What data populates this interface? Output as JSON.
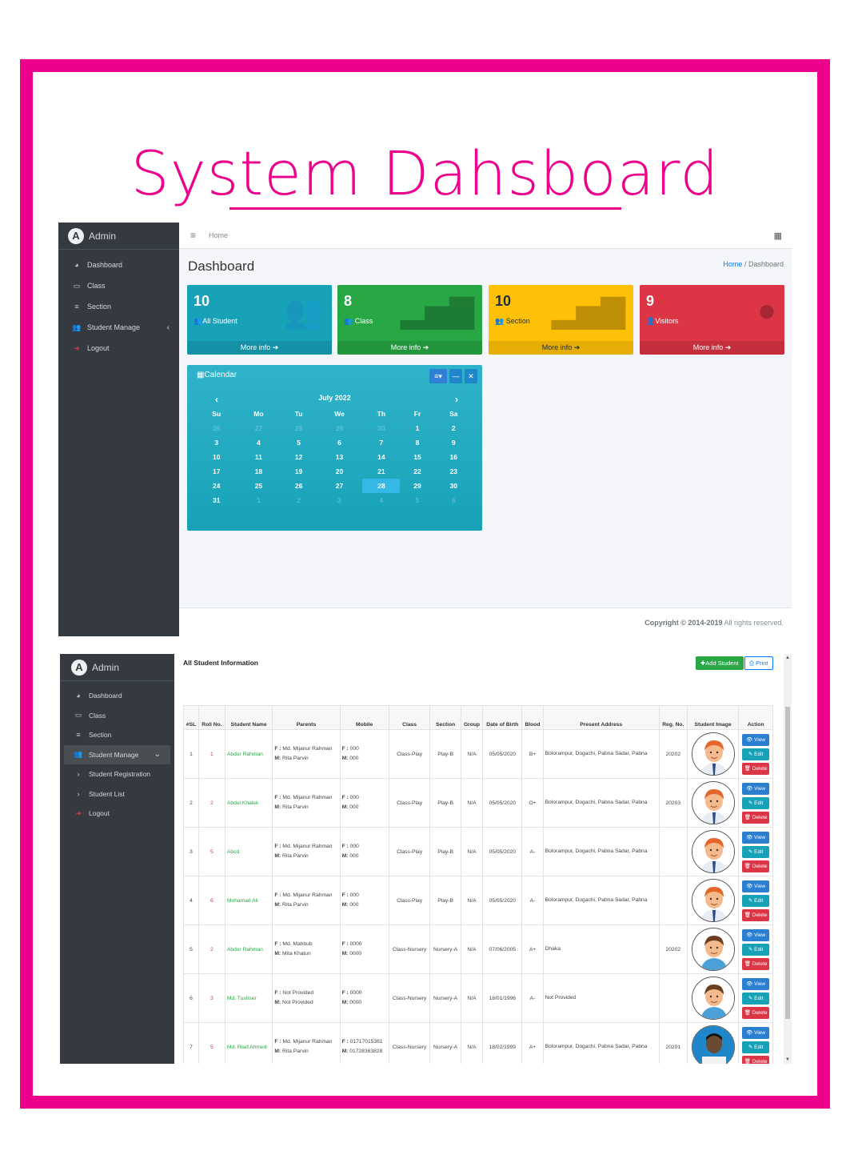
{
  "hero": {
    "title": "System Dahsboard"
  },
  "shot1": {
    "brand": "Admin",
    "nav": [
      {
        "label": "Dashboard",
        "icon": "tachometer-icon"
      },
      {
        "label": "Class",
        "icon": "chalkboard-icon"
      },
      {
        "label": "Section",
        "icon": "bars-icon"
      },
      {
        "label": "Student Manage",
        "icon": "users-icon"
      },
      {
        "label": "Logout",
        "icon": "sign-out-icon"
      }
    ],
    "topbar_home": "Home",
    "page_title": "Dashboard",
    "breadcrumb": {
      "home": "Home",
      "sep": "/",
      "current": "Dashboard"
    },
    "boxes": [
      {
        "value": "10",
        "label": "All Student",
        "more": "More info",
        "color": "#17a2b8"
      },
      {
        "value": "8",
        "label": "Class",
        "more": "More info",
        "color": "#28a745"
      },
      {
        "value": "10",
        "label": "Section",
        "more": "More info",
        "color": "#ffc107"
      },
      {
        "value": "9",
        "label": "Visitors",
        "more": "More info",
        "color": "#dc3545"
      }
    ],
    "calendar": {
      "title": "Calendar",
      "month": "July 2022",
      "weekdays": [
        "Su",
        "Mo",
        "Tu",
        "We",
        "Th",
        "Fr",
        "Sa"
      ],
      "weeks": [
        [
          "26",
          "27",
          "28",
          "29",
          "30",
          "1",
          "2"
        ],
        [
          "3",
          "4",
          "5",
          "6",
          "7",
          "8",
          "9"
        ],
        [
          "10",
          "11",
          "12",
          "13",
          "14",
          "15",
          "16"
        ],
        [
          "17",
          "18",
          "19",
          "20",
          "21",
          "22",
          "23"
        ],
        [
          "24",
          "25",
          "26",
          "27",
          "28",
          "29",
          "30"
        ],
        [
          "31",
          "1",
          "2",
          "3",
          "4",
          "5",
          "6"
        ]
      ],
      "today": "28"
    },
    "footer": {
      "copyright": "Copyright © 2014-2019",
      "rights": " All rights reserved."
    }
  },
  "shot2": {
    "brand": "Admin",
    "nav": [
      {
        "label": "Dashboard"
      },
      {
        "label": "Class"
      },
      {
        "label": "Section"
      },
      {
        "label": "Student Manage"
      },
      {
        "label": "Student Registration"
      },
      {
        "label": "Student List"
      },
      {
        "label": "Logout"
      }
    ],
    "title": "All Student Information",
    "add_button": "Add Student",
    "print_button": "Print",
    "headers": [
      "#SL",
      "Roll No.",
      "Student Name",
      "Parents",
      "Mobile",
      "Class",
      "Section",
      "Group",
      "Date of Birth",
      "Blood",
      "Present Address",
      "Reg. No.",
      "Student Image",
      "Action"
    ],
    "actions": {
      "view": "View",
      "edit": "Edit",
      "delete": "Delete"
    },
    "rows": [
      {
        "sl": "1",
        "roll": "1",
        "name": "Abdur Rahman",
        "father": "Md. Mijanur Rahman",
        "mother": "Rita Parvin",
        "mf": "000",
        "mm": "000",
        "cls": "Class-Play",
        "section": "Play-B",
        "group": "N/A",
        "dob": "05/05/2020",
        "blood": "B+",
        "address": "Bolorampur, Dogachi, Pabna Sadar, Pabna",
        "reg": "20202",
        "avatar": "orange"
      },
      {
        "sl": "2",
        "roll": "2",
        "name": "Abdul Khalek",
        "father": "Md. Mijanur Rahman",
        "mother": "Rita Parvin",
        "mf": "000",
        "mm": "000",
        "cls": "Class-Play",
        "section": "Play-B",
        "group": "N/A",
        "dob": "05/05/2020",
        "blood": "O+",
        "address": "Bolorampur, Dogachi, Pabna Sadar, Pabna",
        "reg": "20203",
        "avatar": "orange"
      },
      {
        "sl": "3",
        "roll": "5",
        "name": "Abcd",
        "father": "Md. Mijanur Rahman",
        "mother": "Rita Parvin",
        "mf": "000",
        "mm": "000",
        "cls": "Class-Play",
        "section": "Play-B",
        "group": "N/A",
        "dob": "05/05/2020",
        "blood": "A-",
        "address": "Bolorampur, Dogachi, Pabna Sadar, Pabna",
        "reg": "",
        "avatar": "orange"
      },
      {
        "sl": "4",
        "roll": "6",
        "name": "Mohamad Ali",
        "father": "Md. Mijanur Rahman",
        "mother": "Rita Parvin",
        "mf": "000",
        "mm": "000",
        "cls": "Class-Play",
        "section": "Play-B",
        "group": "N/A",
        "dob": "05/05/2020",
        "blood": "A-",
        "address": "Bolorampur, Dogachi, Pabna Sadar, Pabna",
        "reg": "",
        "avatar": "orange"
      },
      {
        "sl": "5",
        "roll": "2",
        "name": "Abdur Rahman",
        "father": "Md. Mahbub",
        "mother": "Mita Khatun",
        "mf": "0000",
        "mm": "0000",
        "cls": "Class-Nursery",
        "section": "Nursery-A",
        "group": "N/A",
        "dob": "07/06/2005",
        "blood": "A+",
        "address": "Dhaka",
        "reg": "20202",
        "avatar": "brown"
      },
      {
        "sl": "6",
        "roll": "3",
        "name": "Md. Tushser",
        "father": "Not Provided",
        "mother": "Not Provided",
        "mf": "0000",
        "mm": "0000",
        "cls": "Class-Nursery",
        "section": "Nursery-A",
        "group": "N/A",
        "dob": "18/01/1996",
        "blood": "A-",
        "address": "Not Provided",
        "reg": "",
        "avatar": "brown"
      },
      {
        "sl": "7",
        "roll": "5",
        "name": "Md. Riad Ahmed",
        "father": "Md. Mijanur Rahman",
        "mother": "Rita Parvin",
        "mf": "01717015361",
        "mm": "01728363828",
        "cls": "Class-Nursery",
        "section": "Nursery-A",
        "group": "N/A",
        "dob": "18/02/1999",
        "blood": "A+",
        "address": "Bolorampur, Dogachi, Pabna Sadar, Pabna",
        "reg": "20201",
        "avatar": "photo"
      }
    ]
  }
}
